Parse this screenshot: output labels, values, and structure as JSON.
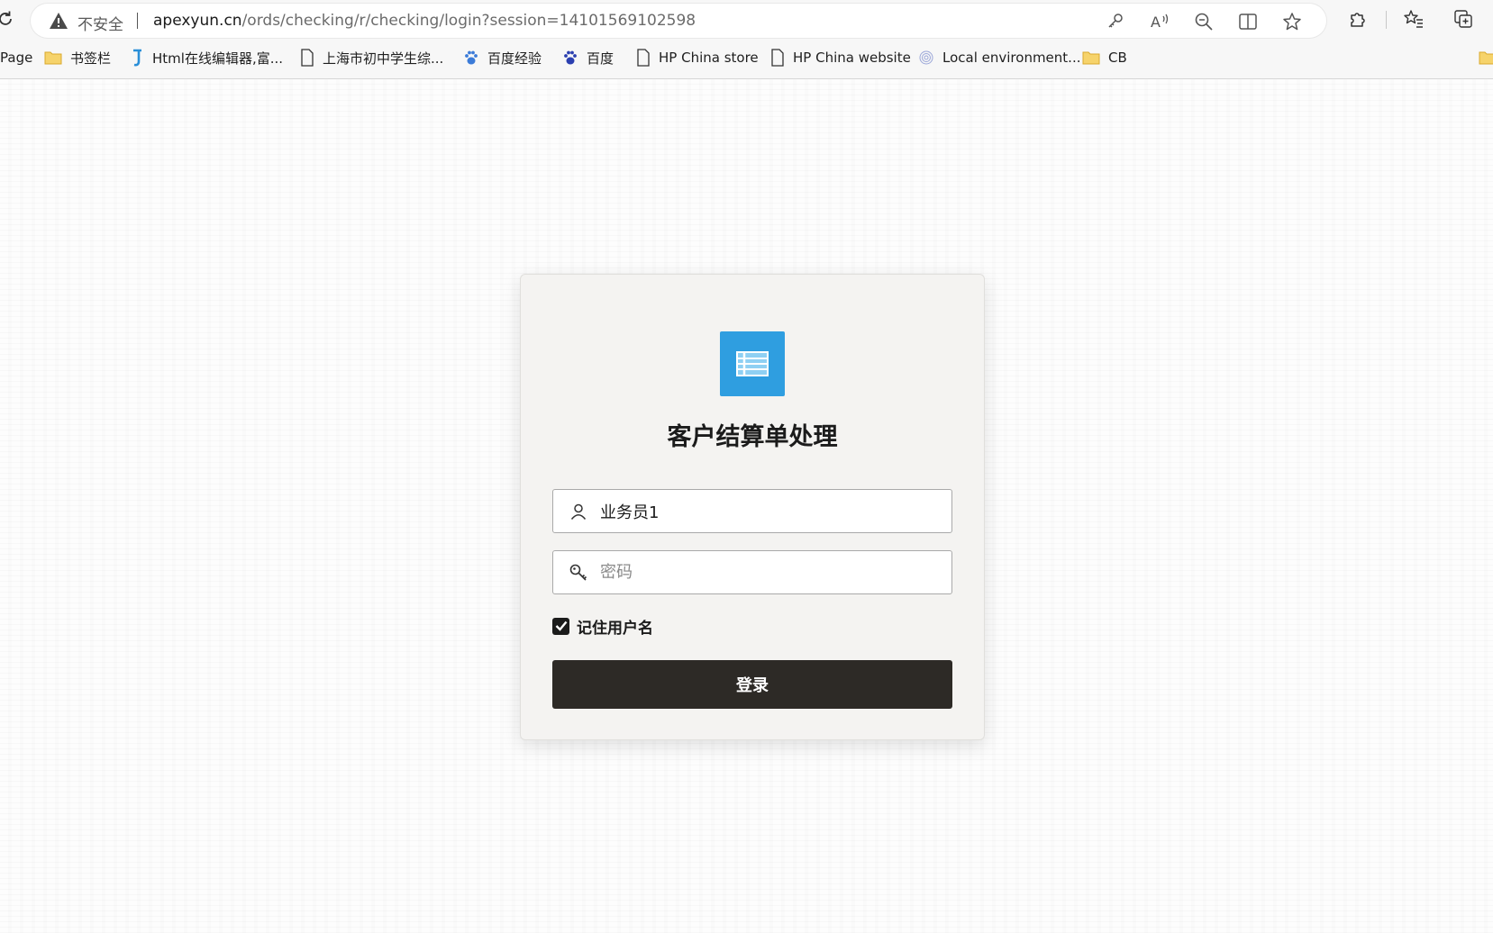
{
  "browser": {
    "security_label": "不安全",
    "url_host": "apexyun.cn",
    "url_path": "/ords/checking/r/checking/login?session=14101569102598",
    "toolbar_icons": [
      "passwords-key-icon",
      "read-aloud-icon",
      "zoom-out-icon",
      "split-screen-icon",
      "favorite-star-icon",
      "extensions-icon",
      "favorites-list-icon",
      "collections-icon"
    ]
  },
  "bookmarks": [
    {
      "label": "Page",
      "icon": "none"
    },
    {
      "label": "书签栏",
      "icon": "folder-icon"
    },
    {
      "label": "Html在线编辑器,富...",
      "icon": "j-logo-icon"
    },
    {
      "label": "上海市初中学生综...",
      "icon": "page-icon"
    },
    {
      "label": "百度经验",
      "icon": "baidu-paw-icon"
    },
    {
      "label": "百度",
      "icon": "baidu-paw-icon"
    },
    {
      "label": "HP China store",
      "icon": "page-icon"
    },
    {
      "label": "HP China website",
      "icon": "page-icon"
    },
    {
      "label": "Local environment...",
      "icon": "fingerprint-icon"
    },
    {
      "label": "CB",
      "icon": "folder-icon"
    }
  ],
  "login": {
    "app_title": "客户结算单处理",
    "username_value": "业务员1",
    "password_placeholder": "密码",
    "remember_label": "记住用户名",
    "remember_checked": true,
    "login_button": "登录"
  },
  "colors": {
    "logo_blue": "#2f9ee0",
    "button_dark": "#2d2a26",
    "card_bg": "#f4f3f1"
  }
}
